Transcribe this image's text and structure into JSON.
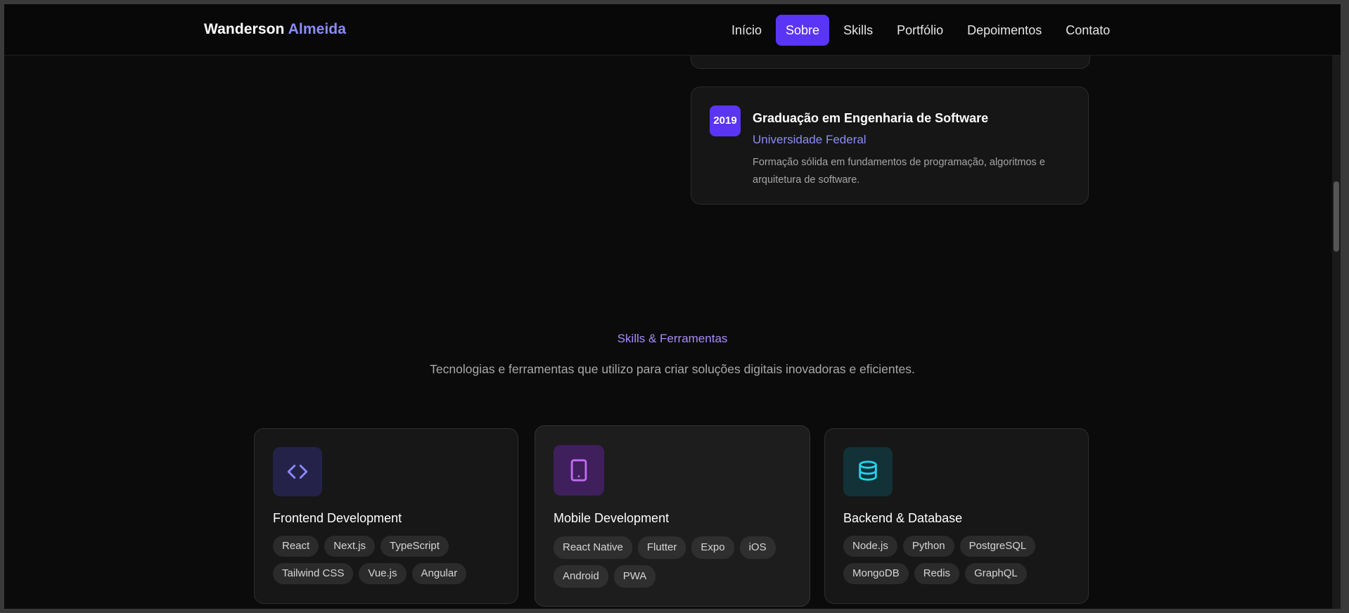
{
  "brand": {
    "first": "Wanderson",
    "last": "Almeida"
  },
  "nav": {
    "items": [
      "Início",
      "Sobre",
      "Skills",
      "Portfólio",
      "Depoimentos",
      "Contato"
    ],
    "active": "Sobre"
  },
  "education": {
    "year": "2019",
    "title": "Graduação em Engenharia de Software",
    "institution": "Universidade Federal",
    "description": "Formação sólida em fundamentos de programação, algoritmos e arquitetura de software."
  },
  "skills_section": {
    "kicker": "Skills & Ferramentas",
    "subtitle": "Tecnologias e ferramentas que utilizo para criar soluções digitais inovadoras e eficientes."
  },
  "skill_cards": [
    {
      "title": "Frontend Development",
      "icon": "code-icon",
      "icon_color": "#8b8cf8",
      "icon_bg": "#25224a",
      "tags": [
        "React",
        "Next.js",
        "TypeScript",
        "Tailwind CSS",
        "Vue.js",
        "Angular"
      ]
    },
    {
      "title": "Mobile Development",
      "icon": "tablet-icon",
      "icon_color": "#c26cf2",
      "icon_bg": "#3f1f5c",
      "tags": [
        "React Native",
        "Flutter",
        "Expo",
        "iOS",
        "Android",
        "PWA"
      ]
    },
    {
      "title": "Backend & Database",
      "icon": "database-icon",
      "icon_color": "#22d3ee",
      "icon_bg": "#123238",
      "tags": [
        "Node.js",
        "Python",
        "PostgreSQL",
        "MongoDB",
        "Redis",
        "GraphQL"
      ]
    }
  ],
  "colors": {
    "accent": "#5b35f5",
    "accent_text": "#8b8cf8",
    "background": "#0b0b0b"
  }
}
